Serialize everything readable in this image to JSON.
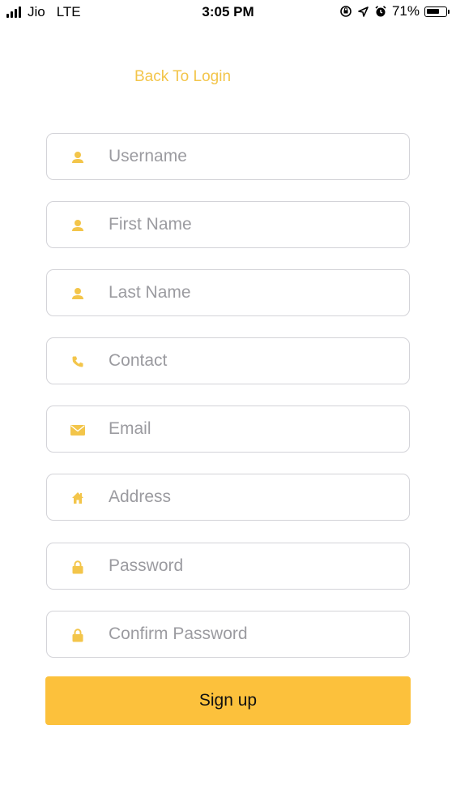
{
  "status_bar": {
    "carrier": "Jio",
    "network": "LTE",
    "time": "3:05 PM",
    "battery_percent": "71%",
    "battery_level": 0.71
  },
  "back_link": "Back To Login",
  "fields": {
    "username": {
      "placeholder": "Username",
      "icon": "user-icon"
    },
    "first_name": {
      "placeholder": "First Name",
      "icon": "user-icon"
    },
    "last_name": {
      "placeholder": "Last Name",
      "icon": "user-icon"
    },
    "contact": {
      "placeholder": "Contact",
      "icon": "phone-icon"
    },
    "email": {
      "placeholder": "Email",
      "icon": "envelope-icon"
    },
    "address": {
      "placeholder": "Address",
      "icon": "home-icon"
    },
    "password": {
      "placeholder": "Password",
      "icon": "lock-icon"
    },
    "confirm_password": {
      "placeholder": "Confirm Password",
      "icon": "lock-icon"
    }
  },
  "signup_label": "Sign up",
  "colors": {
    "accent": "#f3c54a",
    "button": "#fcc13c",
    "field_border": "#d3d3d8",
    "placeholder": "#9b9ba0"
  }
}
